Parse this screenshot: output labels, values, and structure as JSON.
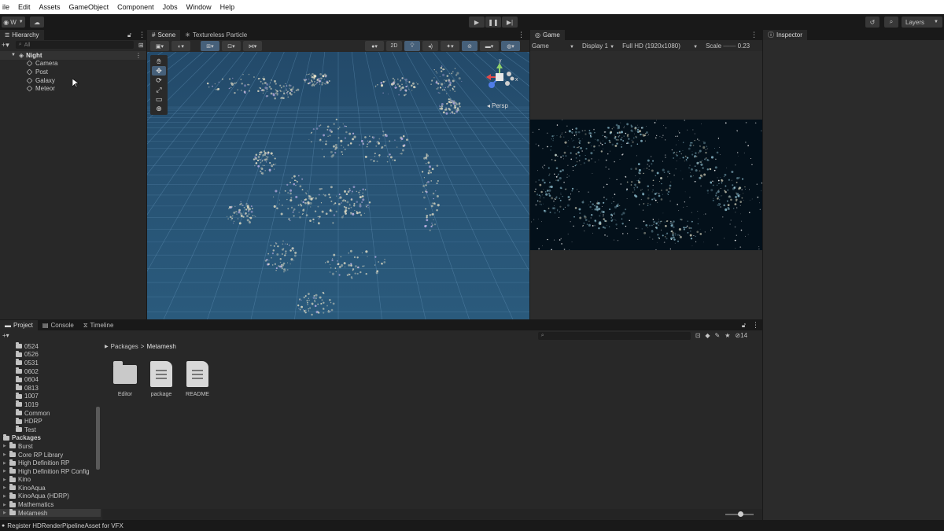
{
  "menu": [
    "ile",
    "Edit",
    "Assets",
    "GameObject",
    "Component",
    "Jobs",
    "Window",
    "Help"
  ],
  "toolbar": {
    "account": "W",
    "layers": "Layers"
  },
  "hierarchy": {
    "title": "Hierarchy",
    "search_placeholder": "All",
    "scene": "Night",
    "children": [
      "Camera",
      "Post",
      "Galaxy",
      "Meteor"
    ]
  },
  "scene_tabs": [
    "Scene",
    "Textureless Particle"
  ],
  "scene_toolbar": {
    "mode_2d": "2D"
  },
  "gizmo": {
    "x": "x",
    "y": "y",
    "persp": "Persp"
  },
  "game": {
    "tab": "Game",
    "mode": "Game",
    "display": "Display 1",
    "resolution": "Full HD (1920x1080)",
    "scale_label": "Scale",
    "scale_value": "0.23"
  },
  "inspector": {
    "title": "Inspector"
  },
  "bottom_tabs": [
    "Project",
    "Console",
    "Timeline"
  ],
  "project": {
    "tree_top": [
      "0524",
      "0526",
      "0531",
      "0602",
      "0604",
      "0813",
      "1007",
      "1019",
      "Common",
      "HDRP",
      "Test"
    ],
    "packages_label": "Packages",
    "packages": [
      "Burst",
      "Core RP Library",
      "High Definition RP",
      "High Definition RP Config",
      "Kino",
      "KinoAqua",
      "KinoAqua (HDRP)",
      "Mathematics",
      "Metamesh"
    ],
    "breadcrumb_root": "Packages",
    "breadcrumb_current": "Metamesh",
    "assets": [
      "Editor",
      "package",
      "README"
    ],
    "count": "14"
  },
  "status": {
    "message": "Register HDRenderPipelineAsset for VFX"
  },
  "colors": {
    "accent": "#3d5a77",
    "scene_sky": "#275273"
  }
}
